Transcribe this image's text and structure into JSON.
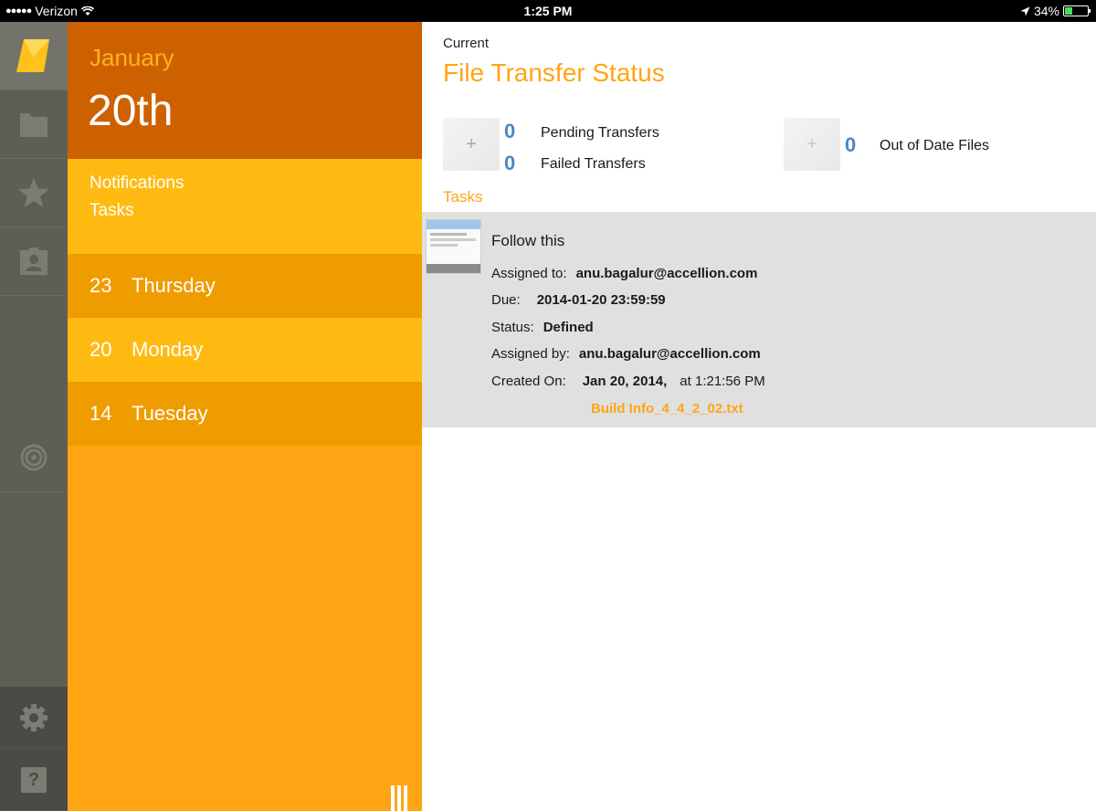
{
  "status_bar": {
    "carrier": "Verizon",
    "time": "1:25 PM",
    "battery": "34%",
    "battery_level": 0.34
  },
  "sidebar_icons": [
    {
      "name": "app-logo-icon"
    },
    {
      "name": "folder-icon"
    },
    {
      "name": "star-icon"
    },
    {
      "name": "contacts-icon"
    },
    {
      "name": "target-icon"
    },
    {
      "name": "gear-icon"
    },
    {
      "name": "help-icon",
      "label": "?"
    }
  ],
  "calendar": {
    "month": "January",
    "day": "20th",
    "notifications_label": "Notifications",
    "tasks_label": "Tasks",
    "days": [
      {
        "num": "23",
        "label": "Thursday"
      },
      {
        "num": "20",
        "label": "Monday"
      },
      {
        "num": "14",
        "label": "Tuesday"
      }
    ]
  },
  "main": {
    "current_label": "Current",
    "title": "File Transfer Status",
    "plus_symbol": "+",
    "pending_count": "0",
    "pending_label": "Pending Transfers",
    "failed_count": "0",
    "failed_label": "Failed Transfers",
    "out_of_date_count": "0",
    "out_of_date_label": "Out of Date Files",
    "tasks_heading": "Tasks"
  },
  "task": {
    "title": "Follow this",
    "assigned_to_label": "Assigned to:",
    "assigned_to": "anu.bagalur@accellion.com",
    "due_label": "Due:",
    "due": "2014-01-20 23:59:59",
    "status_label": "Status:",
    "status": "Defined",
    "assigned_by_label": "Assigned by:",
    "assigned_by": "anu.bagalur@accellion.com",
    "created_label": "Created On:",
    "created_date": "Jan 20, 2014,",
    "created_time": "at  1:21:56 PM",
    "attachment": "Build Info_4_4_2_02.txt"
  }
}
